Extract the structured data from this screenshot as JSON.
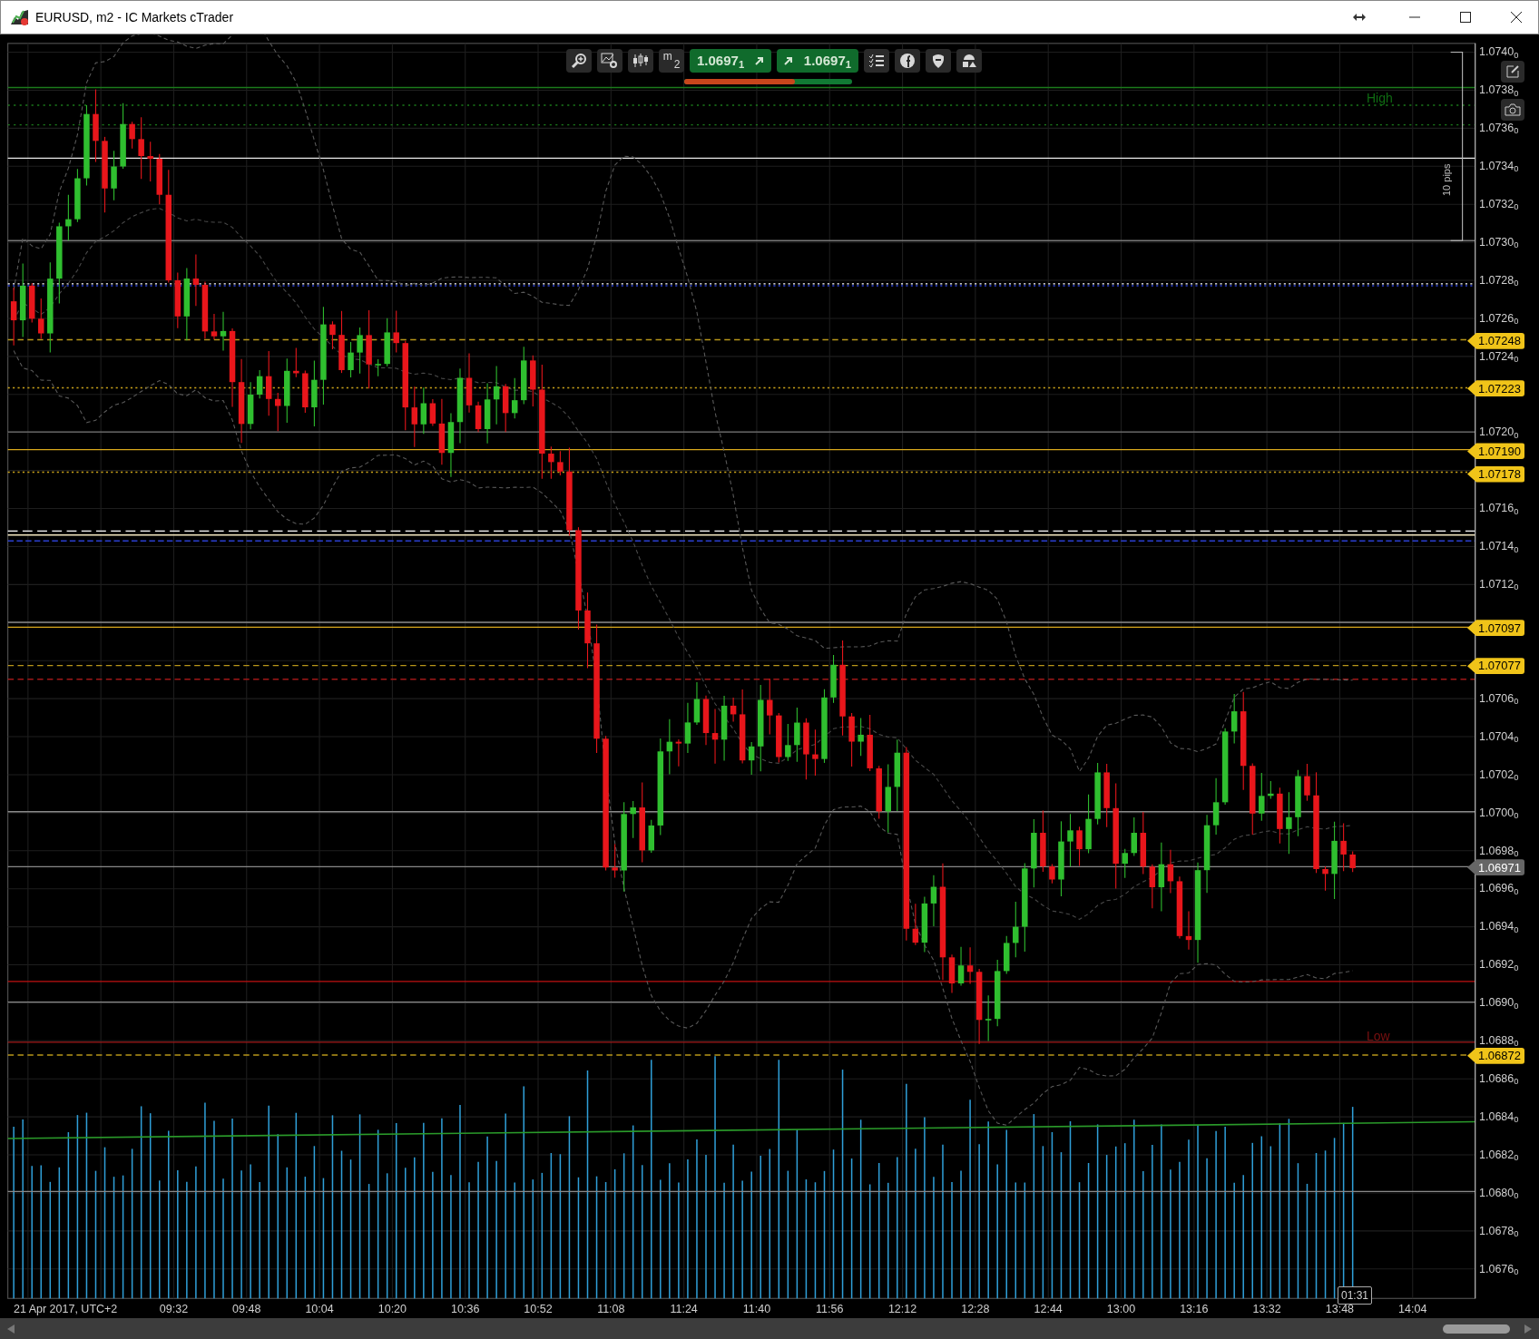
{
  "window": {
    "title": "EURUSD, m2 - IC Markets cTrader"
  },
  "toolbar": {
    "timeframe": {
      "unit": "m",
      "count": "2"
    },
    "bid": "1.0697$_{1}$",
    "ask": "1.0697$_{1}$",
    "sentiment": {
      "level": 0.66
    }
  },
  "chart": {
    "high_label": "High",
    "low_label": "Low",
    "range_label": "10 pips",
    "countdown": "01:31",
    "price_ticks": [
      "1.0740$_{0}$",
      "1.0738$_{0}$",
      "1.0736$_{0}$",
      "1.0734$_{0}$",
      "1.0732$_{0}$",
      "1.0730$_{0}$",
      "1.0728$_{0}$",
      "1.0726$_{0}$",
      "1.0724$_{0}$",
      "1.0720$_{0}$",
      "1.0716$_{0}$",
      "1.0714$_{0}$",
      "1.0712$_{0}$",
      "1.0706$_{0}$",
      "1.0704$_{0}$",
      "1.0702$_{0}$",
      "1.0700$_{0}$",
      "1.0698$_{0}$",
      "1.0696$_{0}$",
      "1.0694$_{0}$",
      "1.0692$_{0}$",
      "1.0690$_{0}$",
      "1.0688$_{0}$",
      "1.0686$_{0}$",
      "1.0684$_{0}$",
      "1.0682$_{0}$",
      "1.0680$_{0}$",
      "1.0678$_{0}$",
      "1.0676$_{0}$"
    ],
    "price_tags": [
      {
        "label": "1.07248",
        "kind": "level"
      },
      {
        "label": "1.07223",
        "kind": "level"
      },
      {
        "label": "1.07190",
        "kind": "level"
      },
      {
        "label": "1.07178",
        "kind": "level"
      },
      {
        "label": "1.07097",
        "kind": "level"
      },
      {
        "label": "1.07077",
        "kind": "level"
      },
      {
        "label": "1.06971",
        "kind": "current"
      },
      {
        "label": "1.06872",
        "kind": "level"
      }
    ],
    "date_label": "21 Apr 2017, UTC+2",
    "time_labels": [
      "09:32",
      "09:48",
      "10:04",
      "10:20",
      "10:36",
      "10:52",
      "11:08",
      "11:24",
      "11:40",
      "11:56",
      "12:12",
      "12:28",
      "12:44",
      "13:00",
      "13:16",
      "13:32",
      "13:48",
      "14:04"
    ]
  }
}
